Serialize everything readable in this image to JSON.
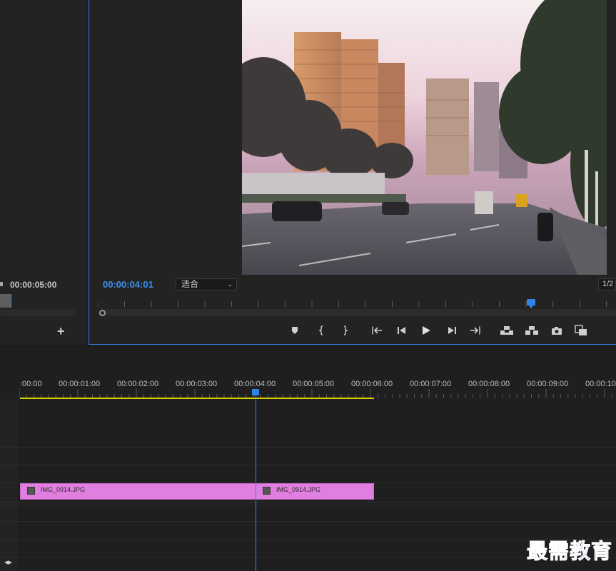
{
  "source_panel": {
    "timecode": "00:00:05:00",
    "add_button": "+"
  },
  "program_monitor": {
    "timecode": "00:00:04:01",
    "zoom_select": "适合",
    "resolution_select": "1/2"
  },
  "transport": {
    "buttons": [
      {
        "name": "add-marker-button",
        "icon": "marker-icon"
      },
      {
        "name": "mark-in-button",
        "icon": "mark-in-icon"
      },
      {
        "name": "mark-out-button",
        "icon": "mark-out-icon"
      },
      {
        "name": "go-to-in-button",
        "icon": "go-to-in-icon"
      },
      {
        "name": "step-back-button",
        "icon": "step-back-icon"
      },
      {
        "name": "play-button",
        "icon": "play-icon"
      },
      {
        "name": "step-forward-button",
        "icon": "step-forward-icon"
      },
      {
        "name": "go-to-out-button",
        "icon": "go-to-out-icon"
      },
      {
        "name": "lift-button",
        "icon": "lift-icon"
      },
      {
        "name": "extract-button",
        "icon": "extract-icon"
      },
      {
        "name": "export-frame-button",
        "icon": "camera-icon"
      },
      {
        "name": "compare-view-button",
        "icon": "compare-icon"
      }
    ]
  },
  "timeline": {
    "ruler_labels": [
      ":00:00",
      "00:00:01:00",
      "00:00:02:00",
      "00:00:03:00",
      "00:00:04:00",
      "00:00:05:00",
      "00:00:06:00",
      "00:00:07:00",
      "00:00:08:00",
      "00:00:09:00",
      "00:00:10"
    ],
    "clips": [
      {
        "label": "IMG_0914.JPG",
        "color": "#e07fe0"
      },
      {
        "label": "IMG_0914.JPG",
        "color": "#e07fe0"
      }
    ],
    "playhead_color": "#2f84e8",
    "work_area_color": "#d9d200"
  },
  "watermark": "最需教育"
}
